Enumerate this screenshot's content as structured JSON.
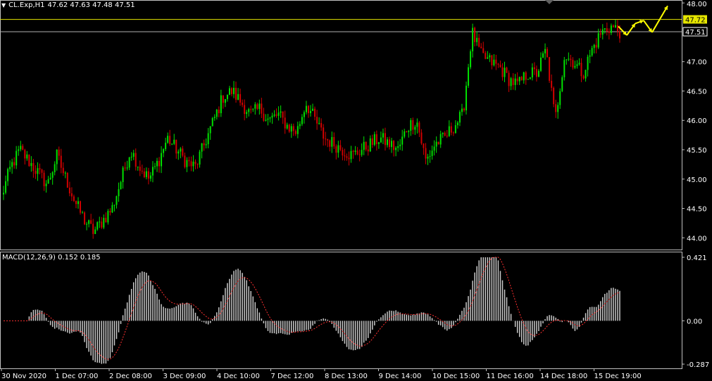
{
  "window": {
    "symbol": "CL.Exp,H1",
    "ohlc": "47.62 47.63 47.48 47.51",
    "menu_icon": "triangle-down-icon"
  },
  "colors": {
    "background": "#000000",
    "grid_frame": "#c0c0c0",
    "bull": "#00e000",
    "bear": "#d00000",
    "ask_line": "#e6e600",
    "bid_line": "#b0b0b0",
    "arrows": "#ffff00",
    "macd_hist": "#c8c8c8",
    "signal": "#ff3030"
  },
  "price_labels": [
    "48.00",
    "47.72",
    "47.51",
    "47.00",
    "46.50",
    "46.00",
    "45.50",
    "45.00",
    "44.50",
    "44.00"
  ],
  "macd": {
    "label": "MACD(12,26,9) 0.152 0.185",
    "axis_labels": [
      "0.421",
      "0.00",
      "-0.287"
    ]
  },
  "time_labels": [
    "30 Nov 2020",
    "1 Dec 07:00",
    "2 Dec 08:00",
    "3 Dec 09:00",
    "4 Dec 10:00",
    "7 Dec 12:00",
    "8 Dec 13:00",
    "9 Dec 14:00",
    "10 Dec 15:00",
    "11 Dec 16:00",
    "14 Dec 18:00",
    "15 Dec 19:00"
  ],
  "chart_data": {
    "type": "candlestick",
    "symbol": "CL.Exp",
    "timeframe": "H1",
    "ylim": [
      43.8,
      48.05
    ],
    "ask": 47.72,
    "bid": 47.51,
    "close_path": [
      44.7,
      45.2,
      45.5,
      45.3,
      45.1,
      44.9,
      45.4,
      45.0,
      44.6,
      44.3,
      44.1,
      44.3,
      44.5,
      45.0,
      45.5,
      45.2,
      45.0,
      45.3,
      45.7,
      45.5,
      45.3,
      45.2,
      45.6,
      46.0,
      46.4,
      46.5,
      46.3,
      46.1,
      46.2,
      46.0,
      46.1,
      45.9,
      45.8,
      46.3,
      46.0,
      45.7,
      45.6,
      45.5,
      45.4,
      45.5,
      45.6,
      45.7,
      45.6,
      45.5,
      45.9,
      46.0,
      45.3,
      45.6,
      45.7,
      45.9,
      46.1,
      47.5,
      47.1,
      47.0,
      46.9,
      46.7,
      46.6,
      46.8,
      46.8,
      47.2,
      46.0,
      47.1,
      47.0,
      46.8,
      47.2,
      47.5,
      47.6,
      47.51
    ],
    "forecast_arrows": [
      [
        47.6,
        47.45
      ],
      [
        47.45,
        47.65
      ],
      [
        47.65,
        47.7
      ],
      [
        47.7,
        47.5
      ],
      [
        47.5,
        47.95
      ]
    ],
    "macd": {
      "ylim": [
        -0.287,
        0.421
      ],
      "current_macd": 0.152,
      "current_signal": 0.185
    }
  }
}
